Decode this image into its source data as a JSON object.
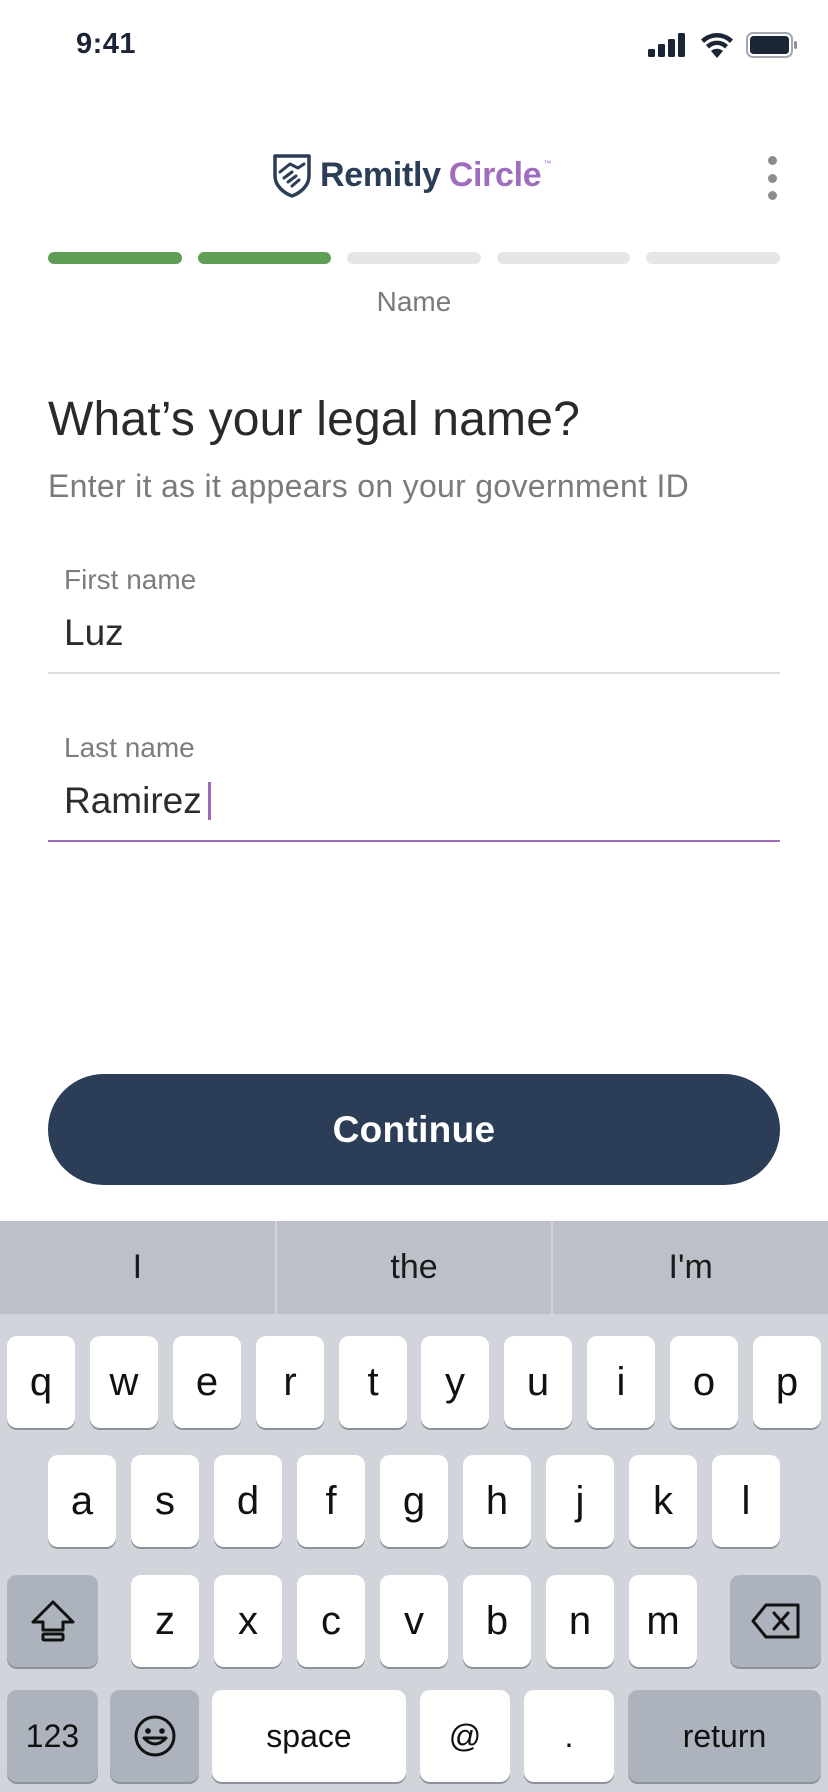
{
  "status_bar": {
    "time": "9:41"
  },
  "header": {
    "logo_primary": "Remitly",
    "logo_secondary": "Circle",
    "logo_tm": "™"
  },
  "progress": {
    "total_steps": 5,
    "completed_steps": 2,
    "step_label": "Name",
    "colors": {
      "done": "#5f9e54",
      "pending": "#e6e6e6"
    }
  },
  "form": {
    "title": "What’s your legal name?",
    "subtitle": "Enter it as it appears on your government ID",
    "first_name": {
      "label": "First name",
      "value": "Luz"
    },
    "last_name": {
      "label": "Last name",
      "value": "Ramirez"
    }
  },
  "continue_label": "Continue",
  "keyboard": {
    "suggestions": [
      "I",
      "the",
      "I'm"
    ],
    "row1": [
      "q",
      "w",
      "e",
      "r",
      "t",
      "y",
      "u",
      "i",
      "o",
      "p"
    ],
    "row2": [
      "a",
      "s",
      "d",
      "f",
      "g",
      "h",
      "j",
      "k",
      "l"
    ],
    "row3": [
      "z",
      "x",
      "c",
      "v",
      "b",
      "n",
      "m"
    ],
    "numbers_label": "123",
    "space_label": "space",
    "at_label": "@",
    "period_label": ".",
    "return_label": "return"
  },
  "colors": {
    "brand_navy": "#2c3e57",
    "brand_purple": "#a06cc0",
    "focus_underline": "#9d6ab4"
  },
  "icons": {
    "signal": "cellular-signal-icon",
    "wifi": "wifi-icon",
    "battery": "battery-icon",
    "logo_mark": "handshake-shield-icon",
    "more": "more-vertical-icon",
    "shift": "shift-icon",
    "delete": "backspace-icon",
    "emoji": "emoji-icon"
  }
}
